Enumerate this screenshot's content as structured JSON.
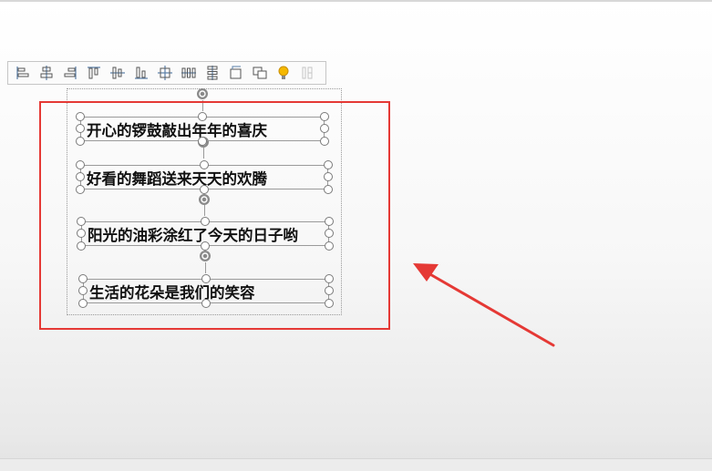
{
  "toolbar": {
    "buttons": [
      {
        "icon": "align-left-icon",
        "enabled": true
      },
      {
        "icon": "align-center-icon",
        "enabled": true
      },
      {
        "icon": "align-right-icon",
        "enabled": true
      },
      {
        "icon": "align-top-icon",
        "enabled": true
      },
      {
        "icon": "align-middle-icon",
        "enabled": true
      },
      {
        "icon": "align-bottom-icon",
        "enabled": true
      },
      {
        "icon": "distribute-horizontal-icon",
        "enabled": true
      },
      {
        "icon": "distribute-horizontal-spacing-icon",
        "enabled": true
      },
      {
        "icon": "distribute-vertical-icon",
        "enabled": true
      },
      {
        "icon": "rotate-icon",
        "enabled": true
      },
      {
        "icon": "group-icon",
        "enabled": true
      },
      {
        "icon": "lightbulb-icon",
        "enabled": true
      },
      {
        "icon": "table-layout-icon",
        "enabled": false
      }
    ]
  },
  "textboxes": [
    {
      "text": "开心的锣鼓敲出年年的喜庆"
    },
    {
      "text": "好看的舞蹈送来天天的欢腾"
    },
    {
      "text": "阳光的油彩涂红了今天的日子哟"
    },
    {
      "text": "生活的花朵是我们的笑容"
    }
  ],
  "colors": {
    "annotation": "#e53935",
    "handle_border": "#7a7a7a",
    "rotate_handle": "#8a8a8a",
    "lightbulb": "#f5b800"
  }
}
